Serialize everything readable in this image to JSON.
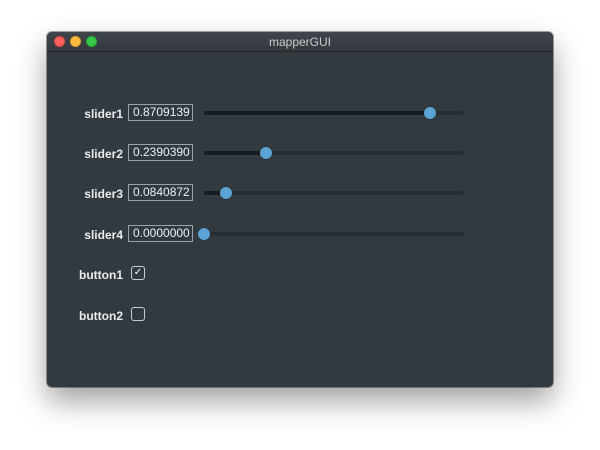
{
  "window": {
    "title": "mapperGUI"
  },
  "sliders": [
    {
      "label": "slider1",
      "value_text": "0.8709139",
      "value": 0.8709139
    },
    {
      "label": "slider2",
      "value_text": "0.2390390",
      "value": 0.239039
    },
    {
      "label": "slider3",
      "value_text": "0.0840872",
      "value": 0.0840872
    },
    {
      "label": "slider4",
      "value_text": "0.0000000",
      "value": 0.0
    }
  ],
  "buttons": [
    {
      "label": "button1",
      "checked": true
    },
    {
      "label": "button2",
      "checked": false
    }
  ],
  "colors": {
    "window_bg": "#323a40",
    "accent_knob": "#5aa3d4",
    "track": "#262d33",
    "track_fill": "#161b1f"
  }
}
